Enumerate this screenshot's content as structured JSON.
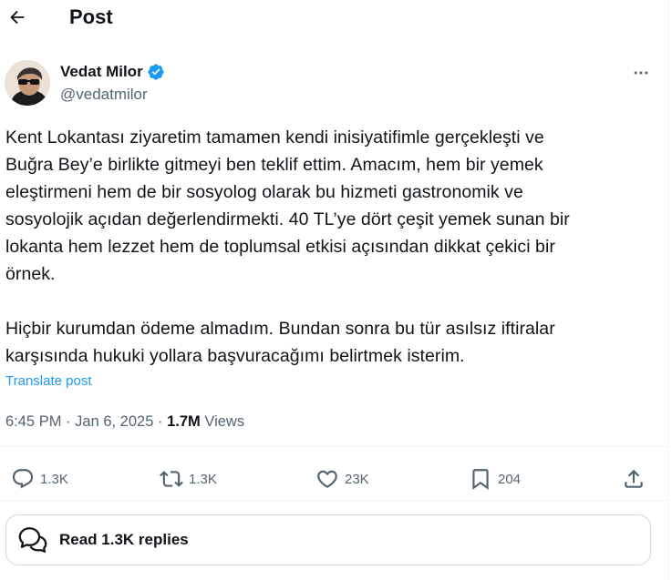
{
  "header": {
    "title": "Post"
  },
  "author": {
    "name": "Vedat Milor",
    "handle": "@vedatmilor"
  },
  "post": {
    "text": "Kent Lokantası ziyaretim tamamen kendi inisiyatifimle gerçekleşti ve\nBuğra Bey’e birlikte gitmeyi ben teklif ettim. Amacım, hem bir yemek\neleştirmeni hem de bir sosyolog olarak bu hizmeti gastronomik ve\nsosyolojik açıdan değerlendirmekti. 40 TL’ye dört çeşit yemek sunan bir\nlokanta hem lezzet hem de toplumsal etkisi açısından dikkat çekici bir\nörnek.\n\nHiçbir kurumdan ödeme almadım. Bundan sonra bu tür asılsız iftiralar\nkarşısında hukuki yollara başvuracağımı belirtmek isterim.",
    "translate_label": "Translate post",
    "time": "6:45 PM",
    "separator": "·",
    "date": "Jan 6, 2025",
    "views_count": "1.7M",
    "views_label": "Views"
  },
  "actions": {
    "replies": "1.3K",
    "reposts": "1.3K",
    "likes": "23K",
    "bookmarks": "204"
  },
  "read_replies": {
    "label": "Read 1.3K replies"
  },
  "colors": {
    "accent": "#1d9bf0",
    "muted": "#536471",
    "text": "#0f1419"
  },
  "icons": [
    "back-arrow-icon",
    "verified-badge-icon",
    "more-icon",
    "reply-icon",
    "repost-icon",
    "like-icon",
    "bookmark-icon",
    "share-icon",
    "chat-bubbles-icon"
  ]
}
